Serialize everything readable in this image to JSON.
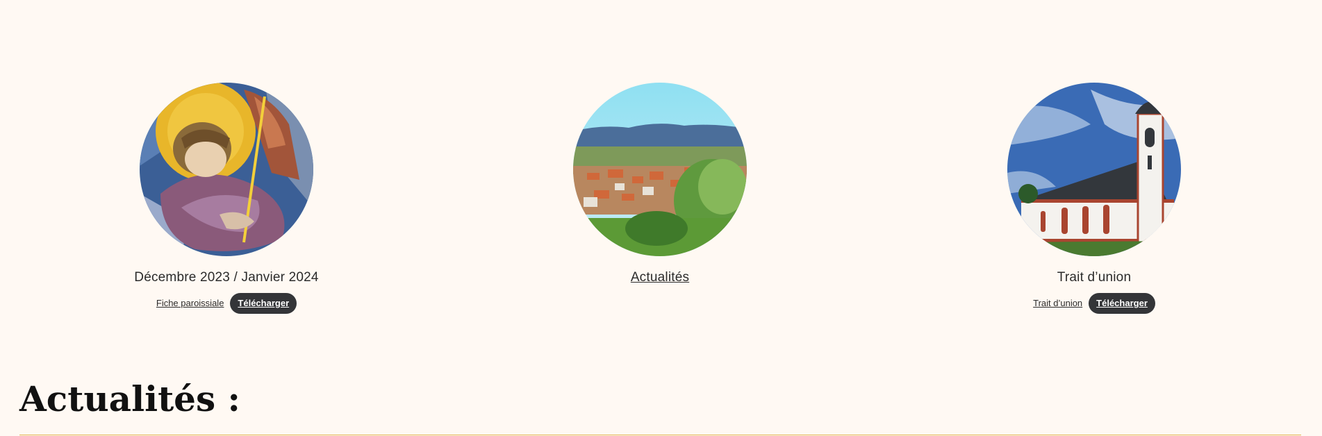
{
  "cards": [
    {
      "image": "angel-fresco-image",
      "title": "Décembre 2023 / Janvier 2024",
      "link_label": "Fiche paroissiale",
      "button_label": "Télécharger"
    },
    {
      "image": "village-landscape-image",
      "title": "Actualités"
    },
    {
      "image": "church-image",
      "title": "Trait d’union",
      "link_label": "Trait d’union",
      "button_label": "Télécharger"
    }
  ],
  "section": {
    "heading": "Actualités :"
  },
  "colors": {
    "background": "#fff9f3",
    "button": "#343538",
    "divider": "#e3b34f"
  }
}
